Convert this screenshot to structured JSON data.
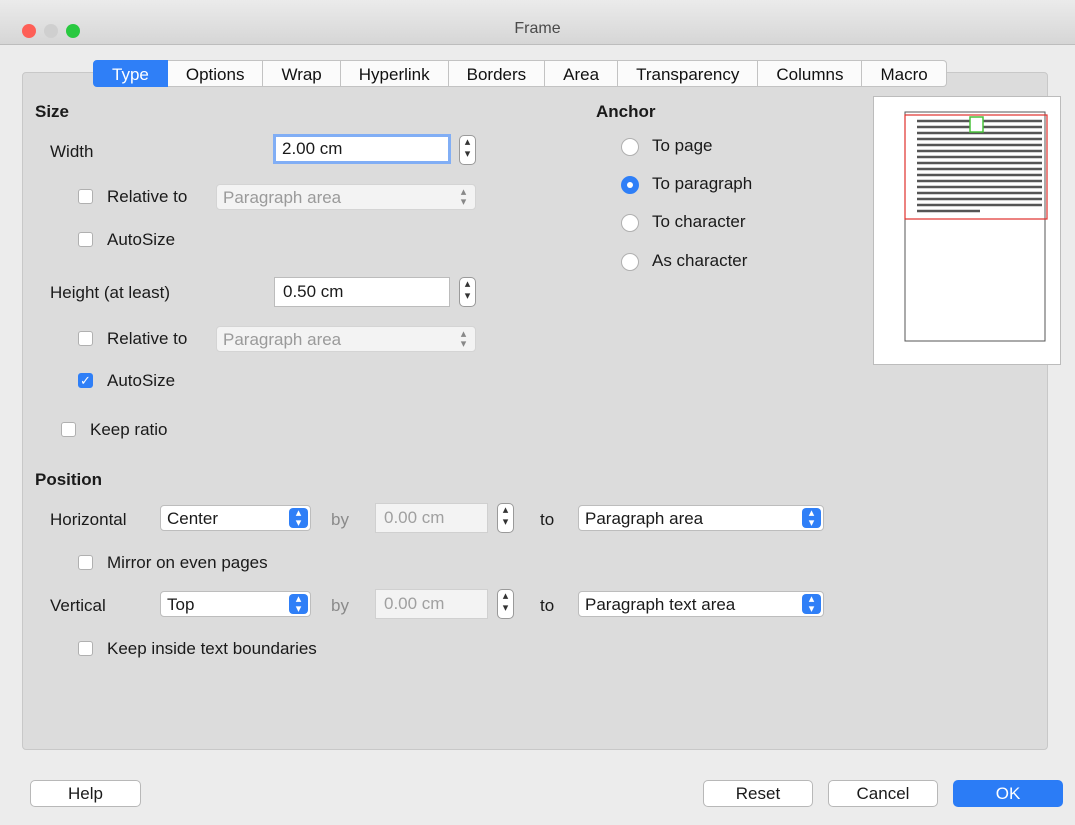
{
  "window": {
    "title": "Frame"
  },
  "tabs": [
    "Type",
    "Options",
    "Wrap",
    "Hyperlink",
    "Borders",
    "Area",
    "Transparency",
    "Columns",
    "Macro"
  ],
  "active_tab": "Type",
  "size": {
    "heading": "Size",
    "width_label": "Width",
    "width_value": "2.00 cm",
    "relative_to_label": "Relative to",
    "relative_to_value": "Paragraph area",
    "autosize_label": "AutoSize",
    "height_label": "Height (at least)",
    "height_value": "0.50 cm",
    "height_relative_to_label": "Relative to",
    "height_relative_to_value": "Paragraph area",
    "height_autosize_label": "AutoSize",
    "height_autosize_checked": true,
    "keep_ratio_label": "Keep ratio"
  },
  "anchor": {
    "heading": "Anchor",
    "options": [
      "To page",
      "To paragraph",
      "To character",
      "As character"
    ],
    "selected": "To paragraph"
  },
  "position": {
    "heading": "Position",
    "horizontal_label": "Horizontal",
    "horizontal_value": "Center",
    "by_label": "by",
    "horizontal_by_value": "0.00 cm",
    "to_label": "to",
    "horizontal_to_value": "Paragraph area",
    "mirror_label": "Mirror on even pages",
    "vertical_label": "Vertical",
    "vertical_value": "Top",
    "vertical_by_value": "0.00 cm",
    "vertical_to_value": "Paragraph text area",
    "keep_inside_label": "Keep inside text boundaries"
  },
  "buttons": {
    "help": "Help",
    "reset": "Reset",
    "cancel": "Cancel",
    "ok": "OK"
  },
  "colors": {
    "accent": "#2f7ff7",
    "close": "#fe5f57",
    "frame_outline": "#e0302b",
    "anchor_marker": "#48c23a"
  }
}
